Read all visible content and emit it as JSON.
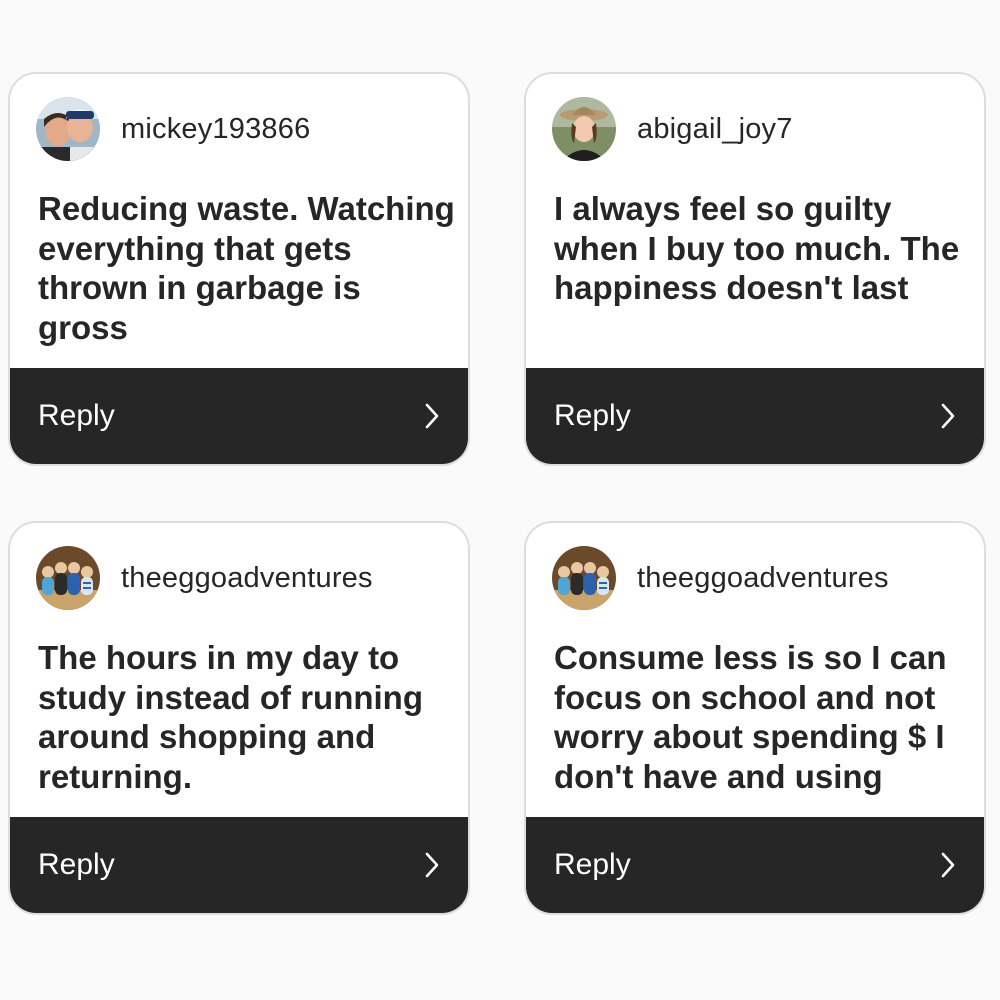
{
  "colors": {
    "page_background": "#fafafa",
    "card_background": "#ffffff",
    "card_border": "#dddddd",
    "reply_bar": "#262626",
    "text_primary": "#262626",
    "reply_text": "#ffffff"
  },
  "cards": [
    {
      "username": "mickey193866",
      "avatar": "couple-selfie-avatar",
      "text": "Reducing waste. Watching everything that gets thrown in garbage is gross",
      "reply_label": "Reply",
      "reply_icon": "chevron-right-icon"
    },
    {
      "username": "abigail_joy7",
      "avatar": "woman-in-hat-avatar",
      "text": "I always feel so guilty when I buy too much. The happiness doesn't last",
      "reply_label": "Reply",
      "reply_icon": "chevron-right-icon"
    },
    {
      "username": "theeggoadventures",
      "avatar": "peg-dolls-avatar",
      "text": "The hours in my day to study instead of running around shopping and returning.",
      "reply_label": "Reply",
      "reply_icon": "chevron-right-icon"
    },
    {
      "username": "theeggoadventures",
      "avatar": "peg-dolls-avatar",
      "text": "Consume less is so I can focus on school and not worry about spending $ I don't have and using",
      "reply_label": "Reply",
      "reply_icon": "chevron-right-icon"
    }
  ]
}
